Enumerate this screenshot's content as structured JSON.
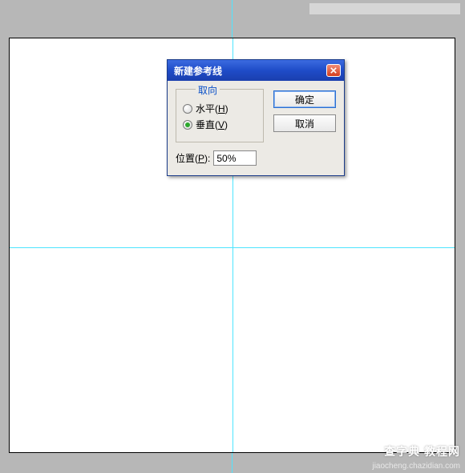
{
  "dialog": {
    "title": "新建参考线",
    "fieldset_legend": "取向",
    "radio_horizontal": "水平(H)",
    "radio_vertical": "垂直(V)",
    "position_label": "位置(P):",
    "position_value": "50%",
    "ok_label": "确定",
    "cancel_label": "取消"
  },
  "watermark": {
    "text": "查字典 教程网",
    "url": "jiaocheng.chazidian.com"
  }
}
